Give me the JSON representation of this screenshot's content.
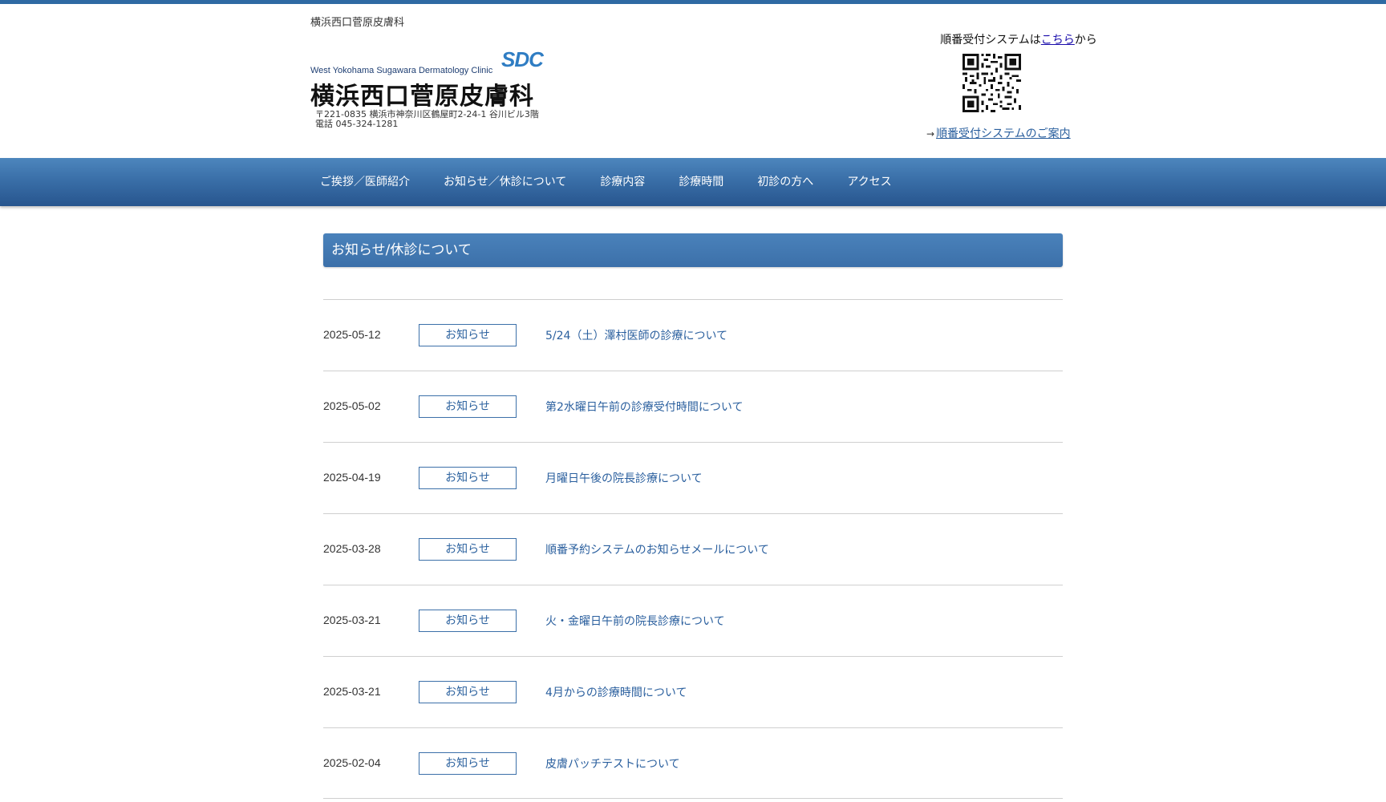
{
  "header": {
    "site_name": "横浜西口菅原皮膚科",
    "logo": {
      "english_name": "West Yokohama Sugawara Dermatology Clinic",
      "mark": "SDC",
      "japanese_name": "横浜西口菅原皮膚科",
      "address": "〒221-0835 横浜市神奈川区鶴屋町2-24-1 谷川ビル3階",
      "phone": "電話 045-324-1281"
    },
    "reception": {
      "prefix": "順番受付システムは",
      "link": "こちら",
      "suffix": "から",
      "guide_arrow": "→",
      "guide_link": "順番受付システムのご案内"
    }
  },
  "nav": {
    "items": [
      {
        "label": "ご挨拶／医師紹介"
      },
      {
        "label": "お知らせ／休診について"
      },
      {
        "label": "診療内容"
      },
      {
        "label": "診療時間"
      },
      {
        "label": "初診の方へ"
      },
      {
        "label": "アクセス"
      }
    ]
  },
  "main": {
    "title": "お知らせ/休診について",
    "news": [
      {
        "date": "2025-05-12",
        "category": "お知らせ",
        "title": "5/24（土）澤村医師の診療について"
      },
      {
        "date": "2025-05-02",
        "category": "お知らせ",
        "title": "第2水曜日午前の診療受付時間について"
      },
      {
        "date": "2025-04-19",
        "category": "お知らせ",
        "title": "月曜日午後の院長診療について"
      },
      {
        "date": "2025-03-28",
        "category": "お知らせ",
        "title": "順番予約システムのお知らせメールについて"
      },
      {
        "date": "2025-03-21",
        "category": "お知らせ",
        "title": "火・金曜日午前の院長診療について"
      },
      {
        "date": "2025-03-21",
        "category": "お知らせ",
        "title": "4月からの診療時間について"
      },
      {
        "date": "2025-02-04",
        "category": "お知らせ",
        "title": "皮膚パッチテストについて"
      }
    ]
  },
  "icons": {
    "qr": "qr-code-icon"
  },
  "colors": {
    "accent": "#3a6fa8",
    "link": "#2a5f9e"
  }
}
